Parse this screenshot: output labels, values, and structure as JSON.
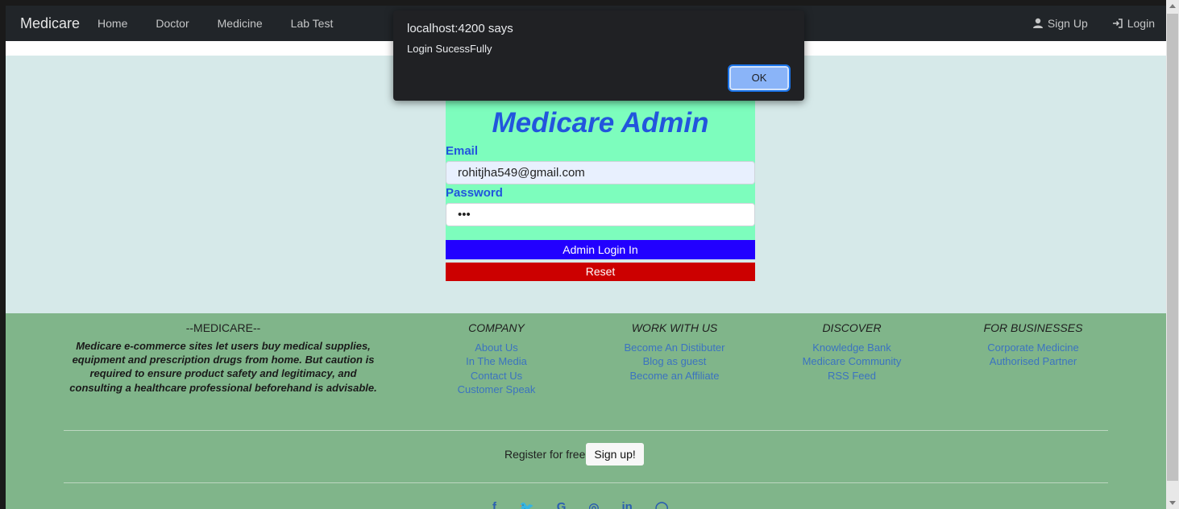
{
  "navbar": {
    "brand": "Medicare",
    "links": [
      "Home",
      "Doctor",
      "Medicine",
      "Lab Test"
    ],
    "signup": "Sign Up",
    "login": "Login"
  },
  "login_form": {
    "title": "Medicare Admin",
    "email_label": "Email",
    "email_value": "rohitjha549@gmail.com",
    "password_label": "Password",
    "password_value": "•••",
    "login_button": "Admin Login In",
    "reset_button": "Reset"
  },
  "footer": {
    "brand_title": "--MEDICARE--",
    "about": "Medicare e-commerce sites let users buy medical supplies, equipment and prescription drugs from home. But caution is required to ensure product safety and legitimacy, and consulting a healthcare professional beforehand is advisable.",
    "company": {
      "title": "COMPANY",
      "links": [
        "About Us",
        "In The Media",
        "Contact Us",
        "Customer Speak"
      ]
    },
    "work": {
      "title": "WORK WITH US",
      "links": [
        "Become An Distibuter",
        "Blog as guest",
        "Become an Affiliate"
      ]
    },
    "discover": {
      "title": "DISCOVER",
      "links": [
        "Knowledge Bank",
        "Medicare Community",
        "RSS Feed"
      ]
    },
    "business": {
      "title": "FOR BUSINESSES",
      "links": [
        "Corporate Medicine",
        "Authorised Partner"
      ]
    },
    "register_text": "Register for free",
    "signup_button": "Sign up!",
    "social": [
      "f",
      "🐦",
      "G",
      "◎",
      "in",
      "◯"
    ]
  },
  "dialog": {
    "title": "localhost:4200 says",
    "message": "Login SucessFully",
    "ok": "OK"
  },
  "colors": {
    "navbar": "#212529",
    "main_bg": "#d6e9e9",
    "login_bg": "#7dfdbd",
    "login_btn": "#2200ff",
    "reset_btn": "#cc0000",
    "footer_bg": "#80b58a"
  }
}
